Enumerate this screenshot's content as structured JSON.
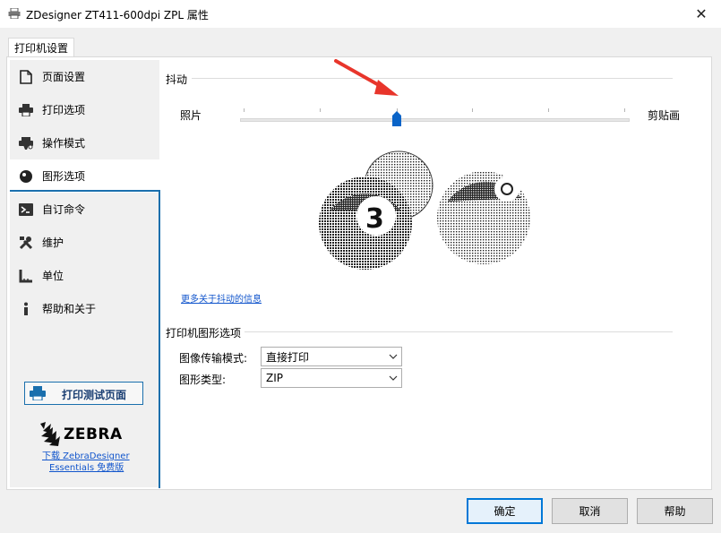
{
  "window": {
    "title": "ZDesigner ZT411-600dpi ZPL 属性",
    "close_glyph": "✕"
  },
  "tab": {
    "label": "打印机设置"
  },
  "sidebar": {
    "items": [
      {
        "label": "页面设置",
        "icon": "page-setup-icon"
      },
      {
        "label": "打印选项",
        "icon": "printer-icon"
      },
      {
        "label": "操作模式",
        "icon": "operation-mode-icon"
      },
      {
        "label": "图形选项",
        "icon": "graphics-icon",
        "active": true
      },
      {
        "label": "自订命令",
        "icon": "command-prompt-icon"
      },
      {
        "label": "维护",
        "icon": "tools-icon"
      },
      {
        "label": "单位",
        "icon": "ruler-icon"
      },
      {
        "label": "帮助和关于",
        "icon": "info-icon"
      }
    ],
    "test_button": "打印测试页面",
    "logo_text": "ZEBRA",
    "download_link_line1": "下载 ZebraDesigner",
    "download_link_line2": "Essentials 免费版"
  },
  "dithering": {
    "section_title": "抖动",
    "left_label": "照片",
    "right_label": "剪贴画",
    "more_link": "更多关于抖动的信息",
    "slider_position": 0.4
  },
  "graphics_options": {
    "section_title": "打印机图形选项",
    "transfer_mode_label": "图像传输模式:",
    "transfer_mode_value": "直接打印",
    "graphic_type_label": "图形类型:",
    "graphic_type_value": "ZIP"
  },
  "buttons": {
    "ok": "确定",
    "cancel": "取消",
    "help": "帮助"
  },
  "colors": {
    "accent": "#1a6fad",
    "link": "#1155cc",
    "arrow": "#e8352b"
  }
}
